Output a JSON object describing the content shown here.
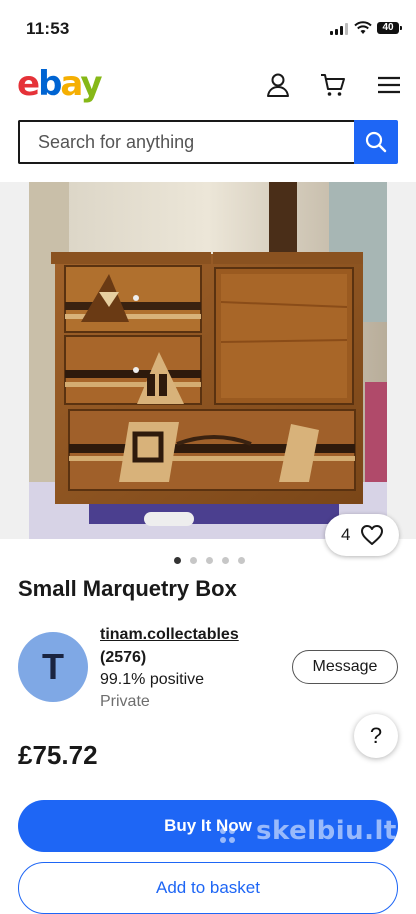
{
  "status_bar": {
    "time": "11:53",
    "battery": "40"
  },
  "header": {
    "logo": {
      "e": "e",
      "b": "b",
      "a": "a",
      "y": "y"
    },
    "icons": [
      "account-icon",
      "cart-icon",
      "menu-icon"
    ]
  },
  "search": {
    "placeholder": "Search for anything",
    "value": ""
  },
  "gallery": {
    "watch_count": "4",
    "total_images": 5,
    "active_image": 1
  },
  "product": {
    "title": "Small Marquetry Box",
    "price": "£75.72"
  },
  "seller": {
    "initial": "T",
    "name": "tinam.collectables",
    "feedback_count": "(2576)",
    "feedback": "99.1% positive",
    "type": "Private",
    "message_label": "Message"
  },
  "help": {
    "label": "?"
  },
  "actions": {
    "buy_now": "Buy It Now",
    "add_to_basket": "Add to basket"
  },
  "watermark": {
    "text": "skelbiu.lt"
  },
  "colors": {
    "accent": "#1e66f5",
    "avatar": "#7fa8e5",
    "logo_e": "#e53238",
    "logo_b": "#0064d2",
    "logo_a": "#f5af02",
    "logo_y": "#86b817"
  }
}
